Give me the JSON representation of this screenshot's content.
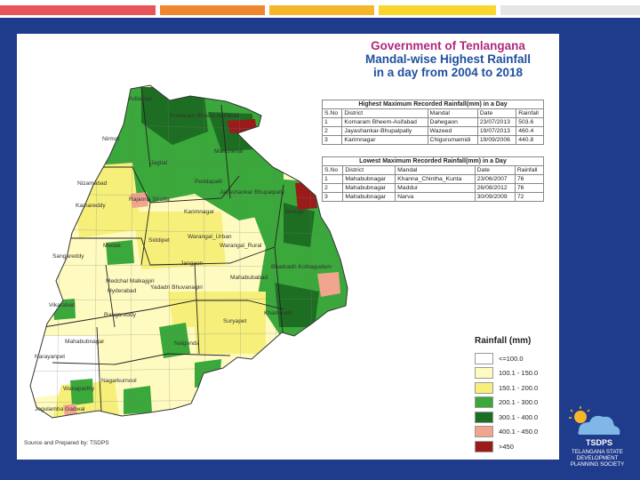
{
  "header": {
    "title_line1": "Government of Tenlangana",
    "title_line2": "Mandal-wise Highest Rainfall",
    "title_line3": "in a day from 2004 to 2018"
  },
  "highest_table": {
    "caption": "Highest Maximum Recorded Rainfall(mm) in a Day",
    "columns": [
      "S.No",
      "District",
      "Mandal",
      "Date",
      "Rainfall"
    ],
    "rows": [
      [
        "1",
        "Komaram Bheem-Asifabad",
        "Dahegaon",
        "23/07/2013",
        "503.6"
      ],
      [
        "2",
        "Jayashankar-Bhupalpally",
        "Wazeed",
        "19/07/2013",
        "460.4"
      ],
      [
        "3",
        "Karimnagar",
        "Chigurumamidi",
        "19/09/2006",
        "440.8"
      ]
    ]
  },
  "lowest_table": {
    "caption": "Lowest Maximum Recorded Rainfall(mm) in a Day",
    "columns": [
      "S.No",
      "District",
      "Mandal",
      "Date",
      "Rainfall"
    ],
    "rows": [
      [
        "1",
        "Mahabubnagar",
        "Khanna_Chintha_Kunta",
        "23/06/2007",
        "76"
      ],
      [
        "2",
        "Mahabubnagar",
        "Maddur",
        "26/08/2012",
        "76"
      ],
      [
        "3",
        "Mahabubnagar",
        "Narva",
        "30/09/2009",
        "72"
      ]
    ]
  },
  "legend": {
    "title": "Rainfall (mm)",
    "items": [
      {
        "label": "<=100.0",
        "color": "#ffffff"
      },
      {
        "label": "100.1 - 150.0",
        "color": "#fffbc0"
      },
      {
        "label": "150.1 - 200.0",
        "color": "#f6f07a"
      },
      {
        "label": "200.1 - 300.0",
        "color": "#3aa83a"
      },
      {
        "label": "300.1 - 400.0",
        "color": "#1d6e22"
      },
      {
        "label": "400.1 - 450.0",
        "color": "#f2a58e"
      },
      {
        "label": ">450",
        "color": "#9b1b1b"
      }
    ]
  },
  "district_labels": [
    "Adilabad",
    "Komaram Bheem Asifabad",
    "Nirmal",
    "Mancherial",
    "Jagtial",
    "Nizamabad",
    "Peddapalli",
    "Jayashankar Bhupalpally",
    "Mulugu",
    "Rajanna Sircilla",
    "Kamareddy",
    "Karimnagar",
    "Siddipet",
    "Medak",
    "Warangal_Urban",
    "Warangal_Rural",
    "Sangareddy",
    "Jangaon",
    "Bhadradri Kothagudem",
    "Medchal Malkajgiri",
    "Mahabubabad",
    "Hyderabad",
    "Yadadri Bhuvanagiri",
    "Vikarabad",
    "Rangareddy",
    "Khammam",
    "Suryapet",
    "Mahabubnagar",
    "Nalgonda",
    "Narayanpet",
    "Nagarkurnool",
    "Wanaparthy",
    "Jogulamba Gadwal"
  ],
  "source_note": "Source and Prepared by: TSDPS",
  "logo": {
    "acronym": "TSDPS",
    "line1": "TELANGANA STATE",
    "line2": "DEVELOPMENT",
    "line3": "PLANNING SOCIETY"
  },
  "colors": {
    "slide_background": "#1f3b8c",
    "title_magenta": "#b0287f",
    "title_blue": "#1f4f9e"
  }
}
